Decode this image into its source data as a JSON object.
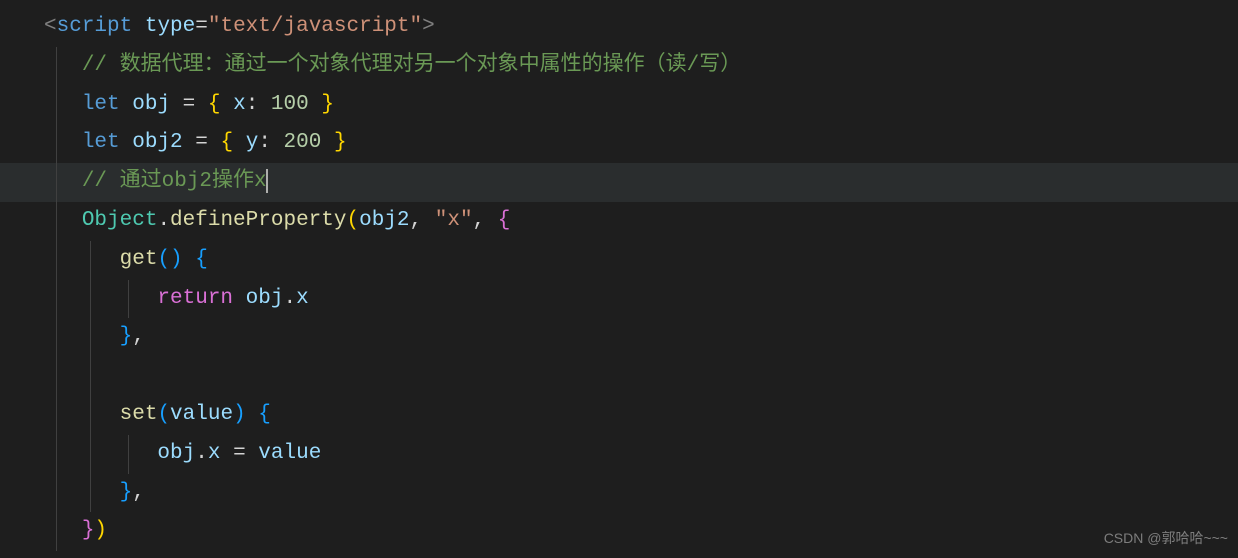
{
  "watermark": "CSDN @郭哈哈~~~",
  "code": {
    "l1": {
      "angle_open": "<",
      "tag": "script",
      "space1": " ",
      "attr": "type",
      "eq": "=",
      "str": "\"text/javascript\"",
      "angle_close": ">"
    },
    "l2": {
      "comment": "// 数据代理：通过一个对象代理对另一个对象中属性的操作（读/写）"
    },
    "l3": {
      "kw": "let",
      "sp1": " ",
      "var": "obj",
      "sp2": " ",
      "eq": "=",
      "sp3": " ",
      "brace_o": "{",
      "sp4": " ",
      "prop": "x",
      "colon": ":",
      "sp5": " ",
      "num": "100",
      "sp6": " ",
      "brace_c": "}"
    },
    "l4": {
      "kw": "let",
      "sp1": " ",
      "var": "obj2",
      "sp2": " ",
      "eq": "=",
      "sp3": " ",
      "brace_o": "{",
      "sp4": " ",
      "prop": "y",
      "colon": ":",
      "sp5": " ",
      "num": "200",
      "sp6": " ",
      "brace_c": "}"
    },
    "l5": {
      "comment": "// 通过obj2操作x"
    },
    "l6": {
      "obj": "Object",
      "dot": ".",
      "fn": "defineProperty",
      "paren_o": "(",
      "arg1": "obj2",
      "comma1": ",",
      "sp1": " ",
      "str": "\"x\"",
      "comma2": ",",
      "sp2": " ",
      "brace_o": "{"
    },
    "l7": {
      "fn": "get",
      "paren_o": "(",
      "paren_c": ")",
      "sp": " ",
      "brace_o": "{"
    },
    "l8": {
      "kw": "return",
      "sp": " ",
      "obj": "obj",
      "dot": ".",
      "prop": "x"
    },
    "l9": {
      "brace_c": "}",
      "comma": ","
    },
    "l10": {},
    "l11": {
      "fn": "set",
      "paren_o": "(",
      "param": "value",
      "paren_c": ")",
      "sp": " ",
      "brace_o": "{"
    },
    "l12": {
      "obj": "obj",
      "dot": ".",
      "prop": "x",
      "sp1": " ",
      "eq": "=",
      "sp2": " ",
      "val": "value"
    },
    "l13": {
      "brace_c": "}",
      "comma": ","
    },
    "l14": {
      "brace_c": "}",
      "paren_c": ")"
    }
  }
}
